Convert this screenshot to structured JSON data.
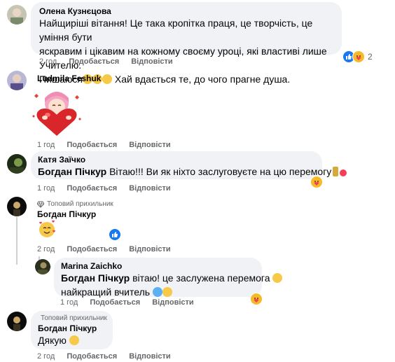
{
  "comments": [
    {
      "author": "Олена Кузнєцова",
      "lines": [
        "Найщиріші вітання! Це така кропітка праця, це творчість, це уміння бути",
        "яскравим і цікавим на кожному своєму уроці, які властиві лише Учителю.",
        "Пишаюся",
        "Хай вдається те, до чого прагне душа."
      ],
      "reaction_count": "2",
      "time": "2 год",
      "like": "Подобається",
      "reply": "Відповісти"
    },
    {
      "author": "Ludmila Feshuk",
      "time": "1 год",
      "like": "Подобається",
      "reply": "Відповісти"
    },
    {
      "author": "Катя Заїчко",
      "mention": "Богдан Пічкур",
      "text": "Вітаю!!! Ви як ніхто заслуговуєте на цю перемогу",
      "time": "1 год",
      "like": "Подобається",
      "reply": "Відповісти"
    },
    {
      "badge": "Топовий прихильник",
      "author": "Богдан Пічкур",
      "time": "2 год",
      "like": "Подобається",
      "reply": "Відповісти"
    },
    {
      "author": "Marina Zaichko",
      "mention": "Богдан Пічкур",
      "text": "вітаю! це заслужена перемога",
      "line2": "найкращий вчитель",
      "time": "1 год",
      "like": "Подобається",
      "reply": "Відповісти"
    },
    {
      "badge": "Топовий прихильник",
      "author": "Богдан Пічкур",
      "text": "Дякую",
      "time": "2 год",
      "like": "Подобається",
      "reply": "Відповісти"
    }
  ],
  "colors": {
    "bubble": "#f0f2f5",
    "meta": "#65676b",
    "like_blue": "#1877f2",
    "heart_red": "#f33e58",
    "haha_yellow": "#f7b928"
  },
  "icons": [
    "diamond-icon",
    "like-reaction-icon",
    "care-reaction-icon",
    "heart-sticker-icon"
  ]
}
